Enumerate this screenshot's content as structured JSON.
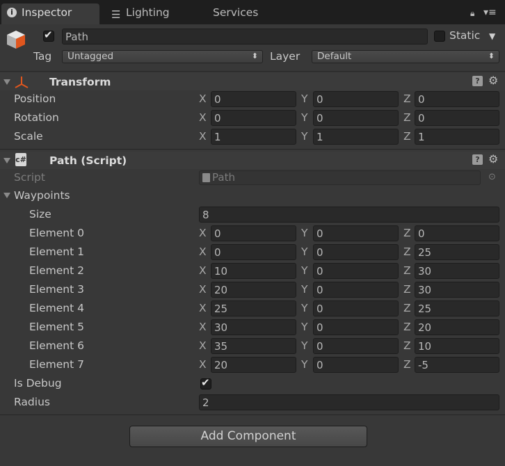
{
  "tabs": [
    {
      "label": "Inspector",
      "icon": "info-icon"
    },
    {
      "label": "Lighting",
      "icon": "sliders-icon"
    },
    {
      "label": "Services"
    }
  ],
  "object": {
    "name": "Path",
    "static_label": "Static",
    "tag_label": "Tag",
    "tag_value": "Untagged",
    "layer_label": "Layer",
    "layer_value": "Default"
  },
  "transform": {
    "title": "Transform",
    "rows": [
      {
        "label": "Position",
        "x": "0",
        "y": "0",
        "z": "0"
      },
      {
        "label": "Rotation",
        "x": "0",
        "y": "0",
        "z": "0"
      },
      {
        "label": "Scale",
        "x": "1",
        "y": "1",
        "z": "1"
      }
    ]
  },
  "path_script": {
    "title": "Path (Script)",
    "script_label": "Script",
    "script_value": "Path",
    "waypoints_label": "Waypoints",
    "size_label": "Size",
    "size_value": "8",
    "elements": [
      {
        "label": "Element 0",
        "x": "0",
        "y": "0",
        "z": "0"
      },
      {
        "label": "Element 1",
        "x": "0",
        "y": "0",
        "z": "25"
      },
      {
        "label": "Element 2",
        "x": "10",
        "y": "0",
        "z": "30"
      },
      {
        "label": "Element 3",
        "x": "20",
        "y": "0",
        "z": "30"
      },
      {
        "label": "Element 4",
        "x": "25",
        "y": "0",
        "z": "25"
      },
      {
        "label": "Element 5",
        "x": "30",
        "y": "0",
        "z": "20"
      },
      {
        "label": "Element 6",
        "x": "35",
        "y": "0",
        "z": "10"
      },
      {
        "label": "Element 7",
        "x": "20",
        "y": "0",
        "z": "-5"
      }
    ],
    "is_debug_label": "Is Debug",
    "is_debug": true,
    "radius_label": "Radius",
    "radius_value": "2"
  },
  "axes": {
    "x": "X",
    "y": "Y",
    "z": "Z"
  },
  "add_component_label": "Add Component"
}
